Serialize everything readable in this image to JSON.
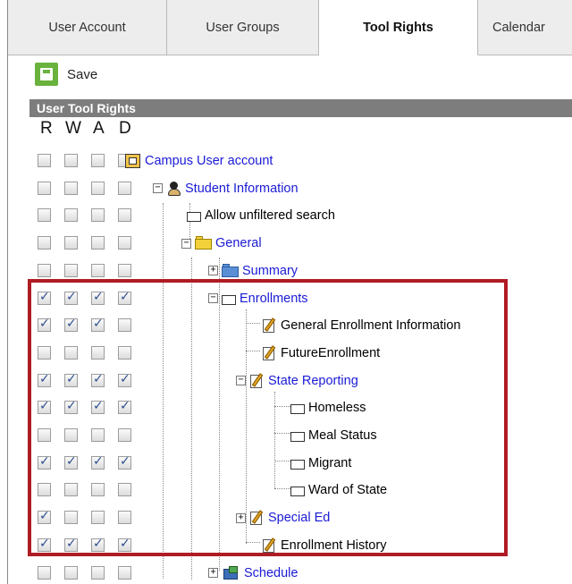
{
  "tabs": [
    {
      "label": "User Account"
    },
    {
      "label": "User Groups"
    },
    {
      "label": "Tool Rights"
    },
    {
      "label": "Calendar"
    }
  ],
  "toolbar": {
    "save_label": "Save"
  },
  "section": {
    "title": "User Tool Rights"
  },
  "columns": {
    "r": "R",
    "w": "W",
    "a": "A",
    "d": "D"
  },
  "colors": {
    "highlight": "#b01c24",
    "link": "#1a1ad6",
    "save_green": "#6ab23e"
  },
  "tree": [
    {
      "label": "Campus User account",
      "link": true,
      "icon": "campus-icon",
      "checks": [
        false,
        false,
        false,
        false
      ]
    },
    {
      "label": "Student Information",
      "link": true,
      "icon": "person-icon",
      "checks": [
        false,
        false,
        false,
        false
      ]
    },
    {
      "label": "Allow unfiltered search",
      "link": false,
      "icon": "document-icon",
      "checks": [
        false,
        false,
        false,
        false
      ]
    },
    {
      "label": "General",
      "link": true,
      "icon": "folder-icon",
      "checks": [
        false,
        false,
        false,
        false
      ]
    },
    {
      "label": "Summary",
      "link": true,
      "icon": "folder-blue-icon",
      "checks": [
        false,
        false,
        false,
        false
      ]
    },
    {
      "label": "Enrollments",
      "link": true,
      "icon": "document-icon",
      "checks": [
        true,
        true,
        true,
        true
      ]
    },
    {
      "label": "General Enrollment Information",
      "link": false,
      "icon": "note-icon",
      "checks": [
        true,
        true,
        true,
        false
      ]
    },
    {
      "label": "FutureEnrollment",
      "link": false,
      "icon": "note-icon",
      "checks": [
        false,
        false,
        false,
        false
      ]
    },
    {
      "label": "State Reporting",
      "link": true,
      "icon": "note-icon",
      "checks": [
        true,
        true,
        true,
        true
      ]
    },
    {
      "label": "Homeless",
      "link": false,
      "icon": "document-icon",
      "checks": [
        true,
        true,
        true,
        true
      ]
    },
    {
      "label": "Meal Status",
      "link": false,
      "icon": "document-icon",
      "checks": [
        false,
        false,
        false,
        false
      ]
    },
    {
      "label": "Migrant",
      "link": false,
      "icon": "document-icon",
      "checks": [
        true,
        true,
        true,
        true
      ]
    },
    {
      "label": "Ward of State",
      "link": false,
      "icon": "document-icon",
      "checks": [
        false,
        false,
        false,
        false
      ]
    },
    {
      "label": "Special Ed",
      "link": true,
      "icon": "note-icon",
      "checks": [
        true,
        false,
        false,
        false
      ]
    },
    {
      "label": "Enrollment History",
      "link": false,
      "icon": "note-icon",
      "checks": [
        true,
        true,
        true,
        true
      ]
    },
    {
      "label": "Schedule",
      "link": true,
      "icon": "schedule-icon",
      "checks": [
        false,
        false,
        false,
        false
      ]
    }
  ]
}
